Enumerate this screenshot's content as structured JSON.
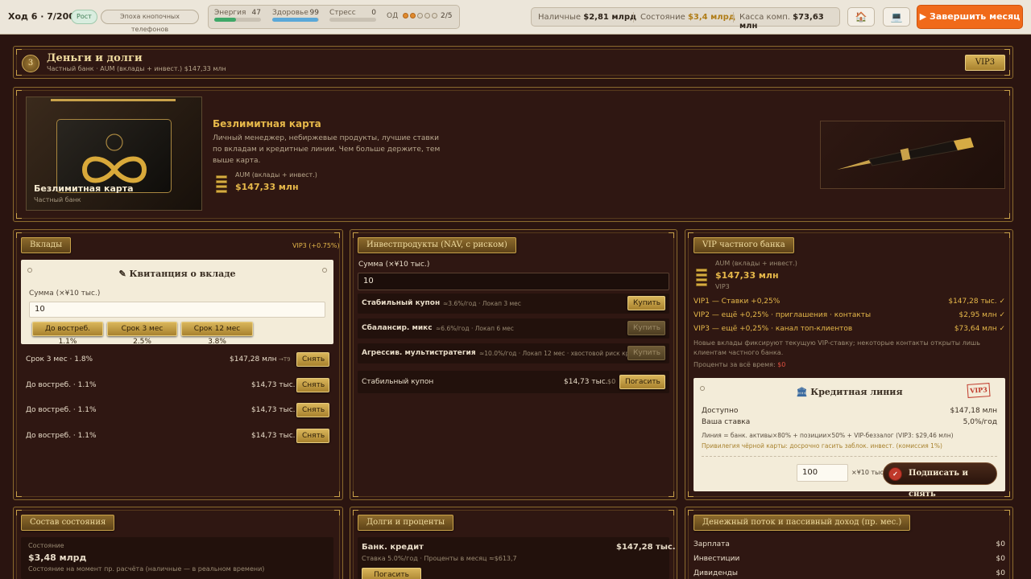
{
  "topbar": {
    "turn": "Ход 6 · 7/2006",
    "growth": "Рост",
    "epoch": "Эпоха кнопочных телефонов",
    "energy": {
      "label": "Энергия",
      "value": "47",
      "level": 0.47,
      "color": "#3fa868"
    },
    "health": {
      "label": "Здоровье",
      "value": "99",
      "level": 0.99,
      "color": "#5aa8d8"
    },
    "stress": {
      "label": "Стресс",
      "value": "0",
      "level": 0,
      "color": "#d05040"
    },
    "od_label": "ОД",
    "od_filled": 2,
    "od_total": 5,
    "od_count": "2/5",
    "cash_label": "Наличные",
    "cash_value": "$2,81 млрд",
    "wealth_label": "Состояние",
    "wealth_value": "$3,4 млрд",
    "company_label": "Касса комп.",
    "company_value": "$73,63 млн",
    "home_icon": "🏠",
    "pc_icon": "💻",
    "end_month": "▶ Завершить месяц"
  },
  "header": {
    "number": "3",
    "title": "Деньги и долги",
    "subtitle": "Частный банк · AUM (вклады + инвест.) $147,33 млн",
    "vip": "VIP3"
  },
  "hero": {
    "card_title": "Безлимитная карта",
    "card_sub": "Частный банк",
    "title": "Безлимитная карта",
    "desc": "Личный менеджер, небиржевые продукты, лучшие ставки по вкладам и кредитные линии. Чем больше держите, тем выше карта.",
    "aum_label": "AUM (вклады + инвест.)",
    "aum_value": "$147,33 млн"
  },
  "deposits": {
    "tab": "Вклады",
    "vip_rate": "VIP3 (+0.75%)",
    "receipt_title": "Квитанция о вкладе",
    "amount_label": "Сумма (×¥10 тыс.)",
    "amount_value": "10",
    "btn_demand": "До востреб. 1.1%",
    "btn_3m": "Срок 3 мес 2.5%",
    "btn_12m": "Срок 12 мес 3.8%",
    "rows": [
      {
        "name": "Срок 3 мес · 1.8%",
        "amount": "$147,28 млн",
        "extra": "→T9",
        "action": "Снять"
      },
      {
        "name": "До востреб. · 1.1%",
        "amount": "$14,73 тыс.",
        "extra": "",
        "action": "Снять"
      },
      {
        "name": "До востреб. · 1.1%",
        "amount": "$14,73 тыс.",
        "extra": "",
        "action": "Снять"
      },
      {
        "name": "До востреб. · 1.1%",
        "amount": "$14,73 тыс.",
        "extra": "",
        "action": "Снять"
      }
    ]
  },
  "invest": {
    "tab": "Инвестпродукты (NAV, с риском)",
    "amount_label": "Сумма (×¥10 тыс.)",
    "amount_value": "10",
    "products": [
      {
        "name": "Стабильный купон",
        "info": "≈3.6%/год · Локап 3 мес",
        "action": "Купить"
      },
      {
        "name": "Сбалансир. микс",
        "info": "≈6.6%/год · Локап 6 мес",
        "action": "Купить"
      },
      {
        "name": "Агрессив. мультистратегия",
        "info": "≈10.0%/год · Локап 12 мес · хвостовой риск краха",
        "action": "Купить"
      }
    ],
    "holding": {
      "name": "Стабильный купон",
      "amount": "$14,73 тыс.",
      "pnl": "$0",
      "action": "Погасить"
    }
  },
  "vip": {
    "tab": "VIP частного банка",
    "aum_label": "AUM (вклады + инвест.)",
    "aum_value": "$147,33 млн",
    "level": "VIP3",
    "tiers": [
      {
        "text": "VIP1 — Ставки +0,25%",
        "value": "$147,28 тыс. ✓"
      },
      {
        "text": "VIP2 — ещё +0,25% · приглашения · контакты",
        "value": "$2,95 млн ✓"
      },
      {
        "text": "VIP3 — ещё +0,25% · канал топ-клиентов",
        "value": "$73,64 млн ✓"
      }
    ],
    "note": "Новые вклады фиксируют текущую VIP-ставку; некоторые контакты открыты лишь клиентам частного банка.",
    "interest_label": "Проценты за всё время:",
    "interest_value": "$0"
  },
  "credit": {
    "title": "Кредитная линия",
    "stamp": "VIP3",
    "available_label": "Доступно",
    "available_value": "$147,18 млн",
    "rate_label": "Ваша ставка",
    "rate_value": "5,0%/год",
    "formula": "Линия = банк. активы×80% + позиции×50% + VIP-беззалог (VIP3: $29,46 млн)",
    "privilege": "Привилегия чёрной карты: досрочно гасить заблок. инвест. (комиссия 1%)",
    "amount_value": "100",
    "amount_unit": "×¥10 тыс.",
    "sign_btn": "Подписать и снять"
  },
  "wealth": {
    "tab": "Состав состояния",
    "label": "Состояние",
    "value": "$3,48 млрд",
    "note": "Состояние на момент пр. расчёта (наличные — в реальном времени)"
  },
  "debts": {
    "tab": "Долги и проценты",
    "loan_name": "Банк. кредит",
    "loan_amount": "$147,28 тыс.",
    "loan_info": "Ставка 5.0%/год · Проценты в месяц ≈$613,7",
    "repay_all": "Погасить всё"
  },
  "cashflow": {
    "tab": "Денежный поток и пассивный доход (пр. мес.)",
    "rows": [
      {
        "name": "Зарплата",
        "value": "$0"
      },
      {
        "name": "Инвестиции",
        "value": "$0"
      },
      {
        "name": "Дивиденды",
        "value": "$0"
      }
    ]
  }
}
